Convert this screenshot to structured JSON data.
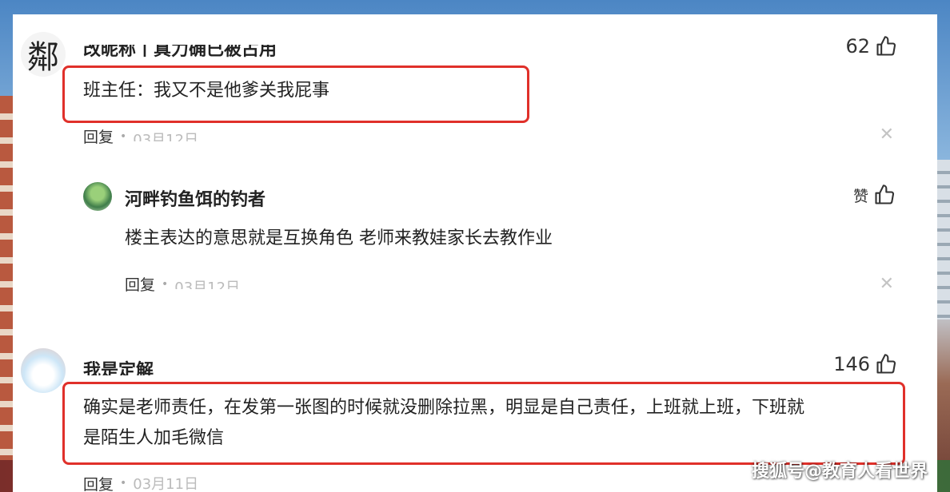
{
  "comments": [
    {
      "username": "改昵称丨真力确已被占用",
      "avatar_glyph": "鄰",
      "likes": "62",
      "text": "班主任：我又不是他爹关我屁事",
      "reply_label": "回复",
      "date": "03月12日",
      "replies": [
        {
          "username": "河畔钓鱼饵的钓者",
          "like_label": "赞",
          "text": "楼主表达的意思就是互换角色 老师来教娃家长去教作业",
          "reply_label": "回复",
          "date": "03月12日"
        }
      ]
    },
    {
      "username": "我是定解",
      "likes": "146",
      "text_line1": "确实是老师责任，在发第一张图的时候就没删除拉黑，明显是自己责任，上班就上班，下班就",
      "text_line2": "是陌生人加毛微信",
      "reply_label": "回复",
      "date": "03月11日"
    }
  ],
  "icons": {
    "like": "thumbs-up-icon",
    "close": "close-icon"
  },
  "colors": {
    "highlight": "#e0302a",
    "text": "#222222",
    "muted": "#bbbbbb"
  },
  "watermark": "搜狐号@教育人看世界"
}
